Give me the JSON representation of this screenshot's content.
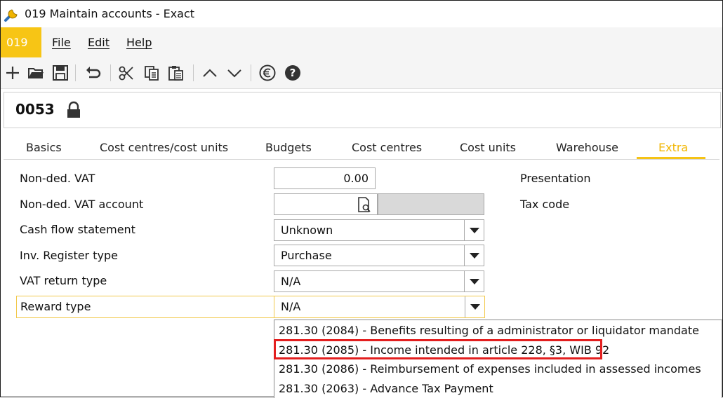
{
  "window": {
    "title": "019 Maintain accounts - Exact",
    "icon": "wrench-icon"
  },
  "menubar": {
    "badge": "019",
    "items": [
      {
        "label": "File",
        "accel": "F"
      },
      {
        "label": "Edit",
        "accel": "E"
      },
      {
        "label": "Help",
        "accel": "H"
      }
    ]
  },
  "toolbar": {
    "icons": [
      "new-icon",
      "open-folder-icon",
      "save-icon",
      "undo-icon",
      "cut-icon",
      "copy-icon",
      "paste-icon",
      "arrow-up-icon",
      "arrow-down-icon",
      "euro-icon",
      "help-icon"
    ]
  },
  "record": {
    "number": "0053",
    "locked": true
  },
  "tabs": [
    {
      "label": "Basics",
      "active": false
    },
    {
      "label": "Cost centres/cost units",
      "active": false
    },
    {
      "label": "Budgets",
      "active": false
    },
    {
      "label": "Cost centres",
      "active": false
    },
    {
      "label": "Cost units",
      "active": false
    },
    {
      "label": "Warehouse",
      "active": false
    },
    {
      "label": "Extra",
      "active": true
    }
  ],
  "form": {
    "non_ded_vat": {
      "label": "Non-ded. VAT",
      "value": "0.00"
    },
    "non_ded_vat_account": {
      "label": "Non-ded. VAT account",
      "value": ""
    },
    "cash_flow": {
      "label": "Cash flow statement",
      "value": "Unknown"
    },
    "inv_register": {
      "label": "Inv. Register type",
      "value": "Purchase"
    },
    "vat_return": {
      "label": "VAT return type",
      "value": "N/A"
    },
    "reward": {
      "label": "Reward type",
      "value": "N/A"
    },
    "presentation": {
      "label": "Presentation"
    },
    "tax_code": {
      "label": "Tax code"
    }
  },
  "reward_options": [
    "281.30 (2084) - Benefits resulting of a administrator or liquidator mandate",
    "281.30 (2085) - Income intended in article 228, §3, WIB 92",
    "281.30 (2086) - Reimbursement of expenses included in assessed incomes",
    "281.30 (2063) - Advance Tax Payment"
  ],
  "colors": {
    "accent": "#f7c515",
    "highlight": "#e31f1f"
  }
}
